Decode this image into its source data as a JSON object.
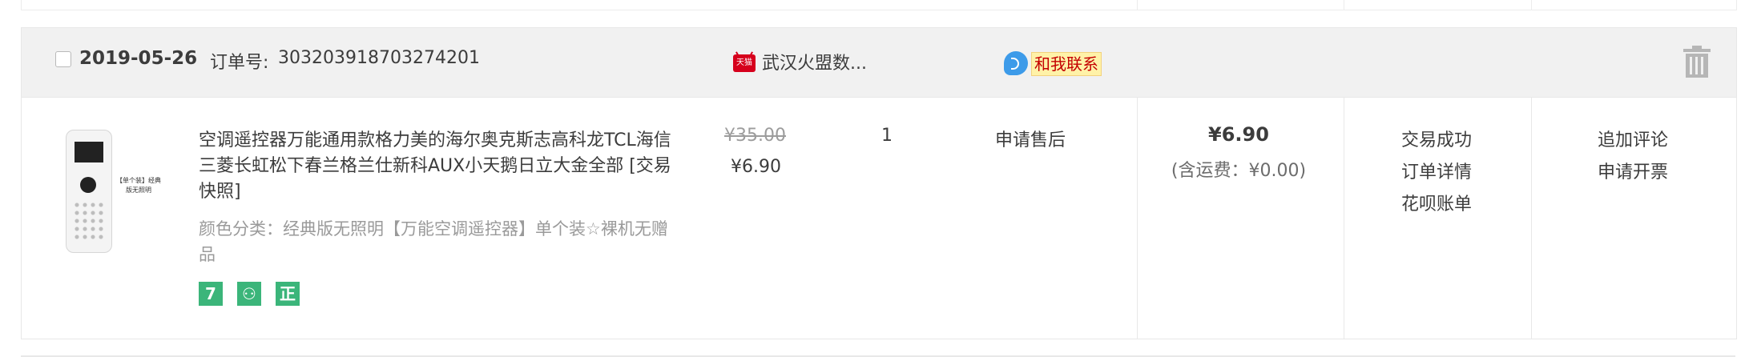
{
  "order": {
    "date": "2019-05-26",
    "order_number_label": "订单号:",
    "order_number": "303203918703274201",
    "shop": {
      "badge_text": "天猫",
      "name": "武汉火盟数..."
    },
    "contact_label": "和我联系",
    "product": {
      "image_tag": "【单个装】经典版无照明",
      "title": "空调遥控器万能通用款格力美的海尔奥克斯志高科龙TCL海信三菱长虹松下春兰格兰仕新科AUX小天鹅日立大金全部 [交易快照]",
      "sku": "颜色分类：经典版无照明【万能空调遥控器】单个装☆裸机无赠品",
      "badges": [
        "7",
        "⚇",
        "正"
      ],
      "original_price": "¥35.00",
      "price": "¥6.90",
      "quantity": "1",
      "after_sale": "申请售后"
    },
    "total": "¥6.90",
    "shipping": "(含运费：¥0.00)",
    "status_links": [
      "交易成功",
      "订单详情",
      "花呗账单"
    ],
    "operation_links": [
      "追加评论",
      "申请开票"
    ]
  },
  "colors": {
    "header_bg": "#f1f1f1",
    "border": "#e8e8e8",
    "contact_bg": "#fff2a8",
    "contact_text": "#c40000",
    "badge_green": "#3bb57a",
    "tmall_red": "#d6001c"
  },
  "icons": {
    "trash": "trash-icon",
    "contact": "chat-bubble-icon",
    "tmall": "tmall-cat-icon"
  }
}
